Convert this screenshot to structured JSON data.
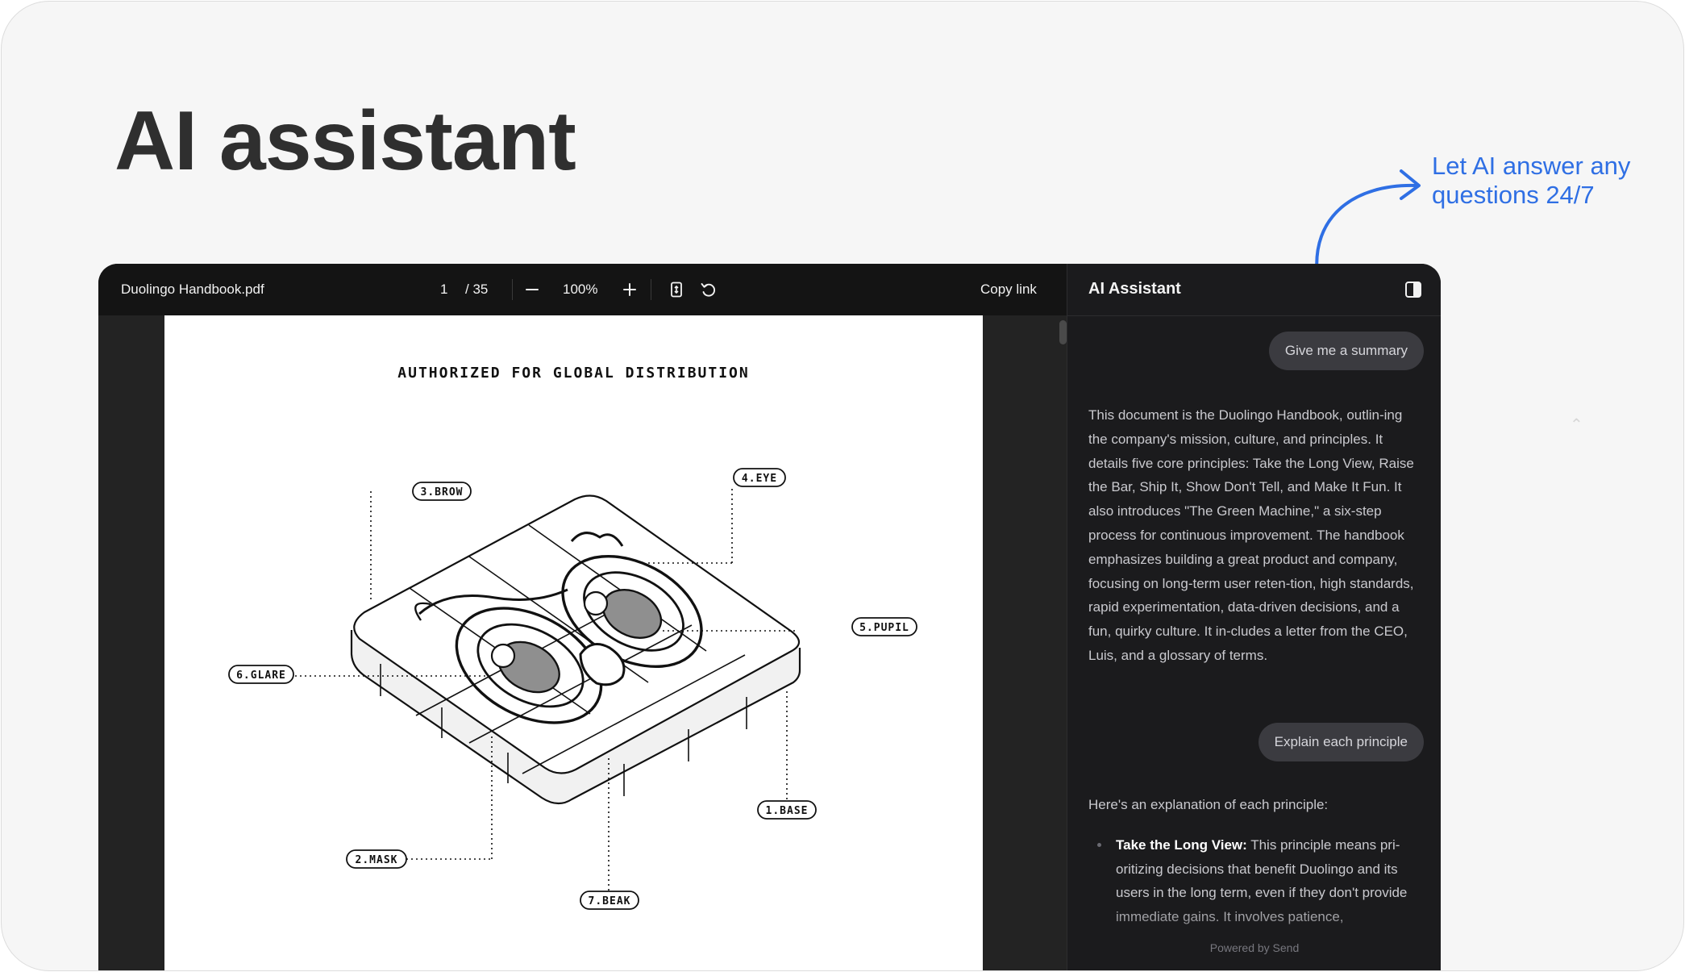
{
  "hero": {
    "title": "AI assistant",
    "callout": "Let AI answer any questions 24/7"
  },
  "colors": {
    "accent": "#2f6fe4",
    "viewer_bg": "#1a1a1b",
    "bubble_bg": "#3b3b40"
  },
  "toolbar": {
    "file_name": "Duolingo Handbook.pdf",
    "page_current": "1",
    "page_total": "/ 35",
    "zoom_out_icon": "minus-icon",
    "zoom": "100%",
    "zoom_in_icon": "plus-icon",
    "fit_page_icon": "fit-page-icon",
    "rotate_icon": "rotate-icon",
    "copy_link": "Copy link"
  },
  "document": {
    "heading": "AUTHORIZED FOR GLOBAL DISTRIBUTION",
    "tags": {
      "base": "1.BASE",
      "mask": "2.MASK",
      "brow": "3.BROW",
      "eye": "4.EYE",
      "pupil": "5.PUPIL",
      "glare": "6.GLARE",
      "beak": "7.BEAK"
    }
  },
  "assistant": {
    "title": "AI Assistant",
    "toggle_icon": "sidebar-toggle-icon",
    "messages": [
      {
        "role": "user",
        "text": "Give me a summary"
      },
      {
        "role": "assistant",
        "text": "This document is the Duolingo Handbook, outlin-ing the company's mission, culture, and principles. It details five core principles: Take the Long View, Raise the Bar, Ship It, Show Don't Tell, and Make It Fun. It also introduces \"The Green Machine,\" a six-step process for continuous improvement. The handbook emphasizes building a great product and company, focusing on long-term user reten-tion, high standards, rapid experimentation, data-driven decisions, and a fun, quirky culture. It in-cludes a letter from the CEO, Luis, and a glossary of terms."
      },
      {
        "role": "user",
        "text": "Explain each principle"
      },
      {
        "role": "assistant",
        "text": "Here's an explanation of each principle:"
      }
    ],
    "principles": [
      {
        "name": "Take the Long View:",
        "text": "This principle means pri-oritizing decisions that benefit Duolingo and its users in the long term, even if they don't provide immediate gains. It involves patience,"
      }
    ],
    "powered_by": "Powered by Send"
  },
  "side_chevron_icon": "chevron-up-icon"
}
